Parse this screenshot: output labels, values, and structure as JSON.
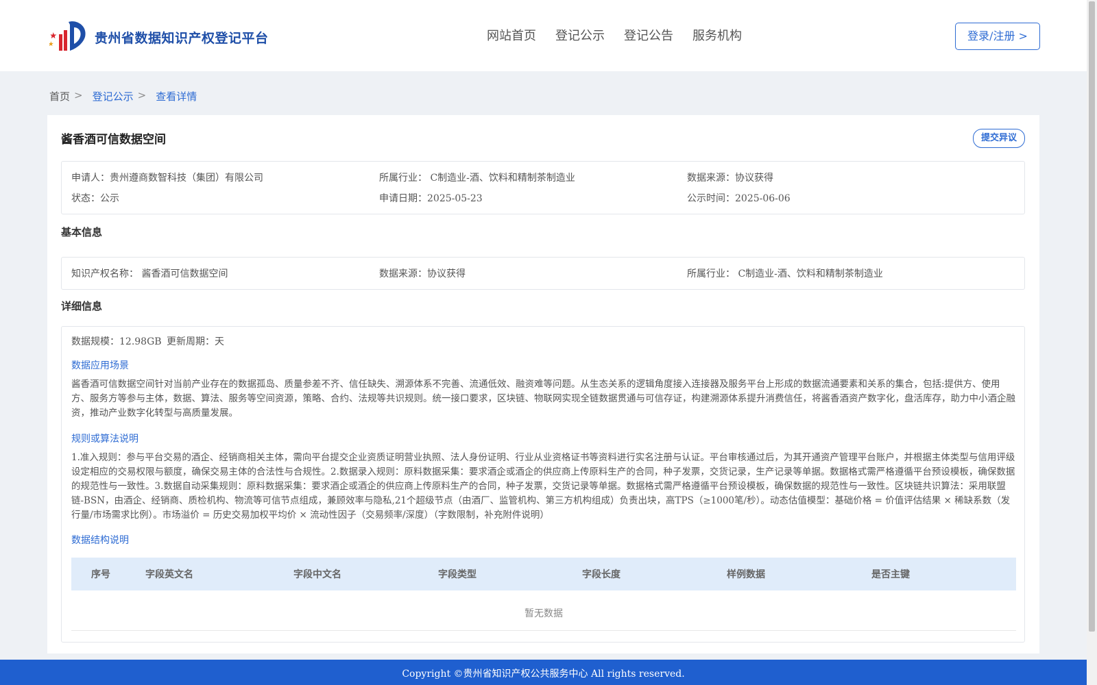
{
  "header": {
    "site_title": "贵州省数据知识产权登记平台",
    "nav": [
      "网站首页",
      "登记公示",
      "登记公告",
      "服务机构"
    ],
    "login_label": "登录/注册 >"
  },
  "breadcrumb": {
    "home": "首页",
    "sep": ">",
    "items": [
      "登记公示",
      "查看详情"
    ]
  },
  "record": {
    "title": "酱香酒可信数据空间",
    "objection_label": "提交异议",
    "summary": {
      "applicant": "申请人：贵州遵商数智科技（集团）有限公司",
      "industry": "所属行业： C制造业-酒、饮料和精制茶制造业",
      "source": "数据来源：协议获得",
      "status": "状态：公示",
      "apply_date": "申请日期：2025-05-23",
      "publish_date": "公示时间：2025-06-06"
    }
  },
  "basic": {
    "section_title": "基本信息",
    "ip_name": "知识产权名称： 酱香酒可信数据空间",
    "source": "数据来源：协议获得",
    "industry": "所属行业： C制造业-酒、饮料和精制茶制造业"
  },
  "detail": {
    "section_title": "详细信息",
    "scale": "数据规模：12.98GB",
    "cycle": "更新周期：天",
    "scenario_title": "数据应用场景",
    "scenario_text": "酱香酒可信数据空间针对当前产业存在的数据孤岛、质量参差不齐、信任缺失、溯源体系不完善、流通低效、融资难等问题。从生态关系的逻辑角度接入连接器及服务平台上形成的数据流通要素和关系的集合，包括:提供方、使用方、服务方等参与主体，数据、算法、服务等空间资源，策略、合约、法规等共识规则。统一接口要求，区块链、物联网实现全链数据贯通与可信存证，构建溯源体系提升消费信任，将酱香酒资产数字化，盘活库存，助力中小酒企融资，推动产业数字化转型与高质量发展。",
    "rules_title": "规则或算法说明",
    "rules_text": "1.准入规则：参与平台交易的酒企、经销商相关主体，需向平台提交企业资质证明营业执照、法人身份证明、行业从业资格证书等资料进行实名注册与认证。平台审核通过后，为其开通资产管理平台账户，并根据主体类型与信用评级设定相应的交易权限与额度，确保交易主体的合法性与合规性。2.数据录入规则：原料数据采集：要求酒企或酒企的供应商上传原料生产的合同，种子发票，交货记录，生产记录等单据。数据格式需严格遵循平台预设模板，确保数据的规范性与一致性。3.数据自动采集规则：原料数据采集：要求酒企或酒企的供应商上传原料生产的合同，种子发票，交货记录等单据。数据格式需严格遵循平台预设模板，确保数据的规范性与一致性。区块链共识算法：采用联盟链-BSN，由酒企、经销商、质检机构、物流等可信节点组成，兼顾效率与隐私,21个超级节点（由酒厂、监管机构、第三方机构组成）负责出块，高TPS（≥1000笔/秒）。动态估值模型：基础价格 = 价值评估结果 × 稀缺系数（发行量/市场需求比例）。市场溢价 = 历史交易加权平均价 × 流动性因子（交易频率/深度）（字数限制，补充附件说明）",
    "structure_title": "数据结构说明",
    "table_headers": [
      "序号",
      "字段英文名",
      "字段中文名",
      "字段类型",
      "字段长度",
      "样例数据",
      "是否主键"
    ],
    "empty_text": "暂无数据"
  },
  "footer": {
    "copyright": "Copyright ©贵州省知识产权公共服务中心 All rights reserved."
  },
  "colors": {
    "brand_blue": "#1f4fa8",
    "link_blue": "#2d6bd3",
    "footer_blue": "#1f5fcf",
    "table_head_bg": "#e0ecfa"
  }
}
